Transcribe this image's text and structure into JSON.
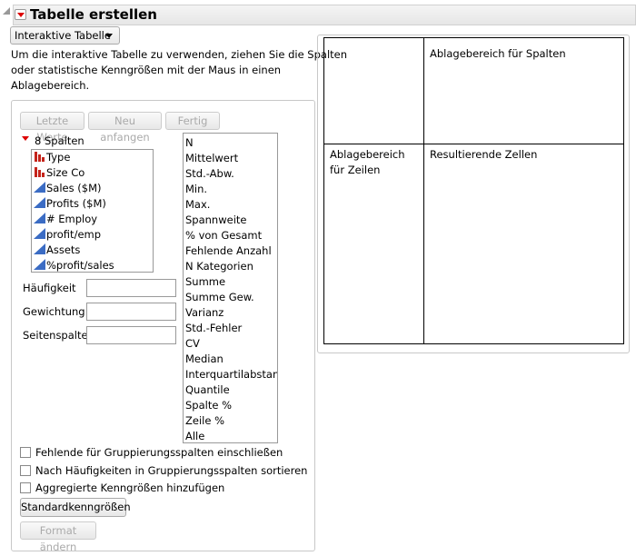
{
  "header": {
    "title": "Tabelle erstellen"
  },
  "mode_dropdown": {
    "value": "Interaktive Tabelle"
  },
  "instructions": [
    "Um die interaktive Tabelle zu verwenden, ziehen Sie die Spalten",
    "oder statistische Kenngrößen mit der Maus in einen",
    "Ablagebereich."
  ],
  "buttons": {
    "last_values": "Letzte Werte",
    "restart": "Neu anfangen",
    "done": "Fertig",
    "default_stats": "Standardkenngrößen",
    "change_format": "Format ändern"
  },
  "columns": {
    "header": "8 Spalten",
    "items": [
      {
        "name": "Type",
        "type": "nominal"
      },
      {
        "name": "Size Co",
        "type": "nominal"
      },
      {
        "name": "Sales ($M)",
        "type": "continuous"
      },
      {
        "name": "Profits ($M)",
        "type": "continuous"
      },
      {
        "name": "# Employ",
        "type": "continuous"
      },
      {
        "name": "profit/emp",
        "type": "continuous"
      },
      {
        "name": "Assets",
        "type": "continuous"
      },
      {
        "name": "%profit/sales",
        "type": "continuous"
      }
    ]
  },
  "statistics": [
    "N",
    "Mittelwert",
    "Std.-Abw.",
    "Min.",
    "Max.",
    "Spannweite",
    "% von Gesamt",
    "Fehlende Anzahl",
    "N Kategorien",
    "Summe",
    "Summe Gew.",
    "Varianz",
    "Std.-Fehler",
    "CV",
    "Median",
    "Interquartilabstand",
    "Quantile",
    "Spalte %",
    "Zeile %",
    "Alle"
  ],
  "roles": [
    {
      "label": "Häufigkeit",
      "value": ""
    },
    {
      "label": "Gewichtung",
      "value": ""
    },
    {
      "label": "Seitenspalte",
      "value": ""
    }
  ],
  "options": [
    {
      "label": "Fehlende für Gruppierungsspalten einschließen",
      "checked": false
    },
    {
      "label": "Nach Häufigkeiten in Gruppierungsspalten sortieren",
      "checked": false
    },
    {
      "label": "Aggregierte Kenngrößen hinzufügen",
      "checked": false
    }
  ],
  "drop_zones": {
    "columns": "Ablagebereich für Spalten",
    "rows": "Ablagebereich für Zeilen",
    "cells": "Resultierende Zellen"
  }
}
